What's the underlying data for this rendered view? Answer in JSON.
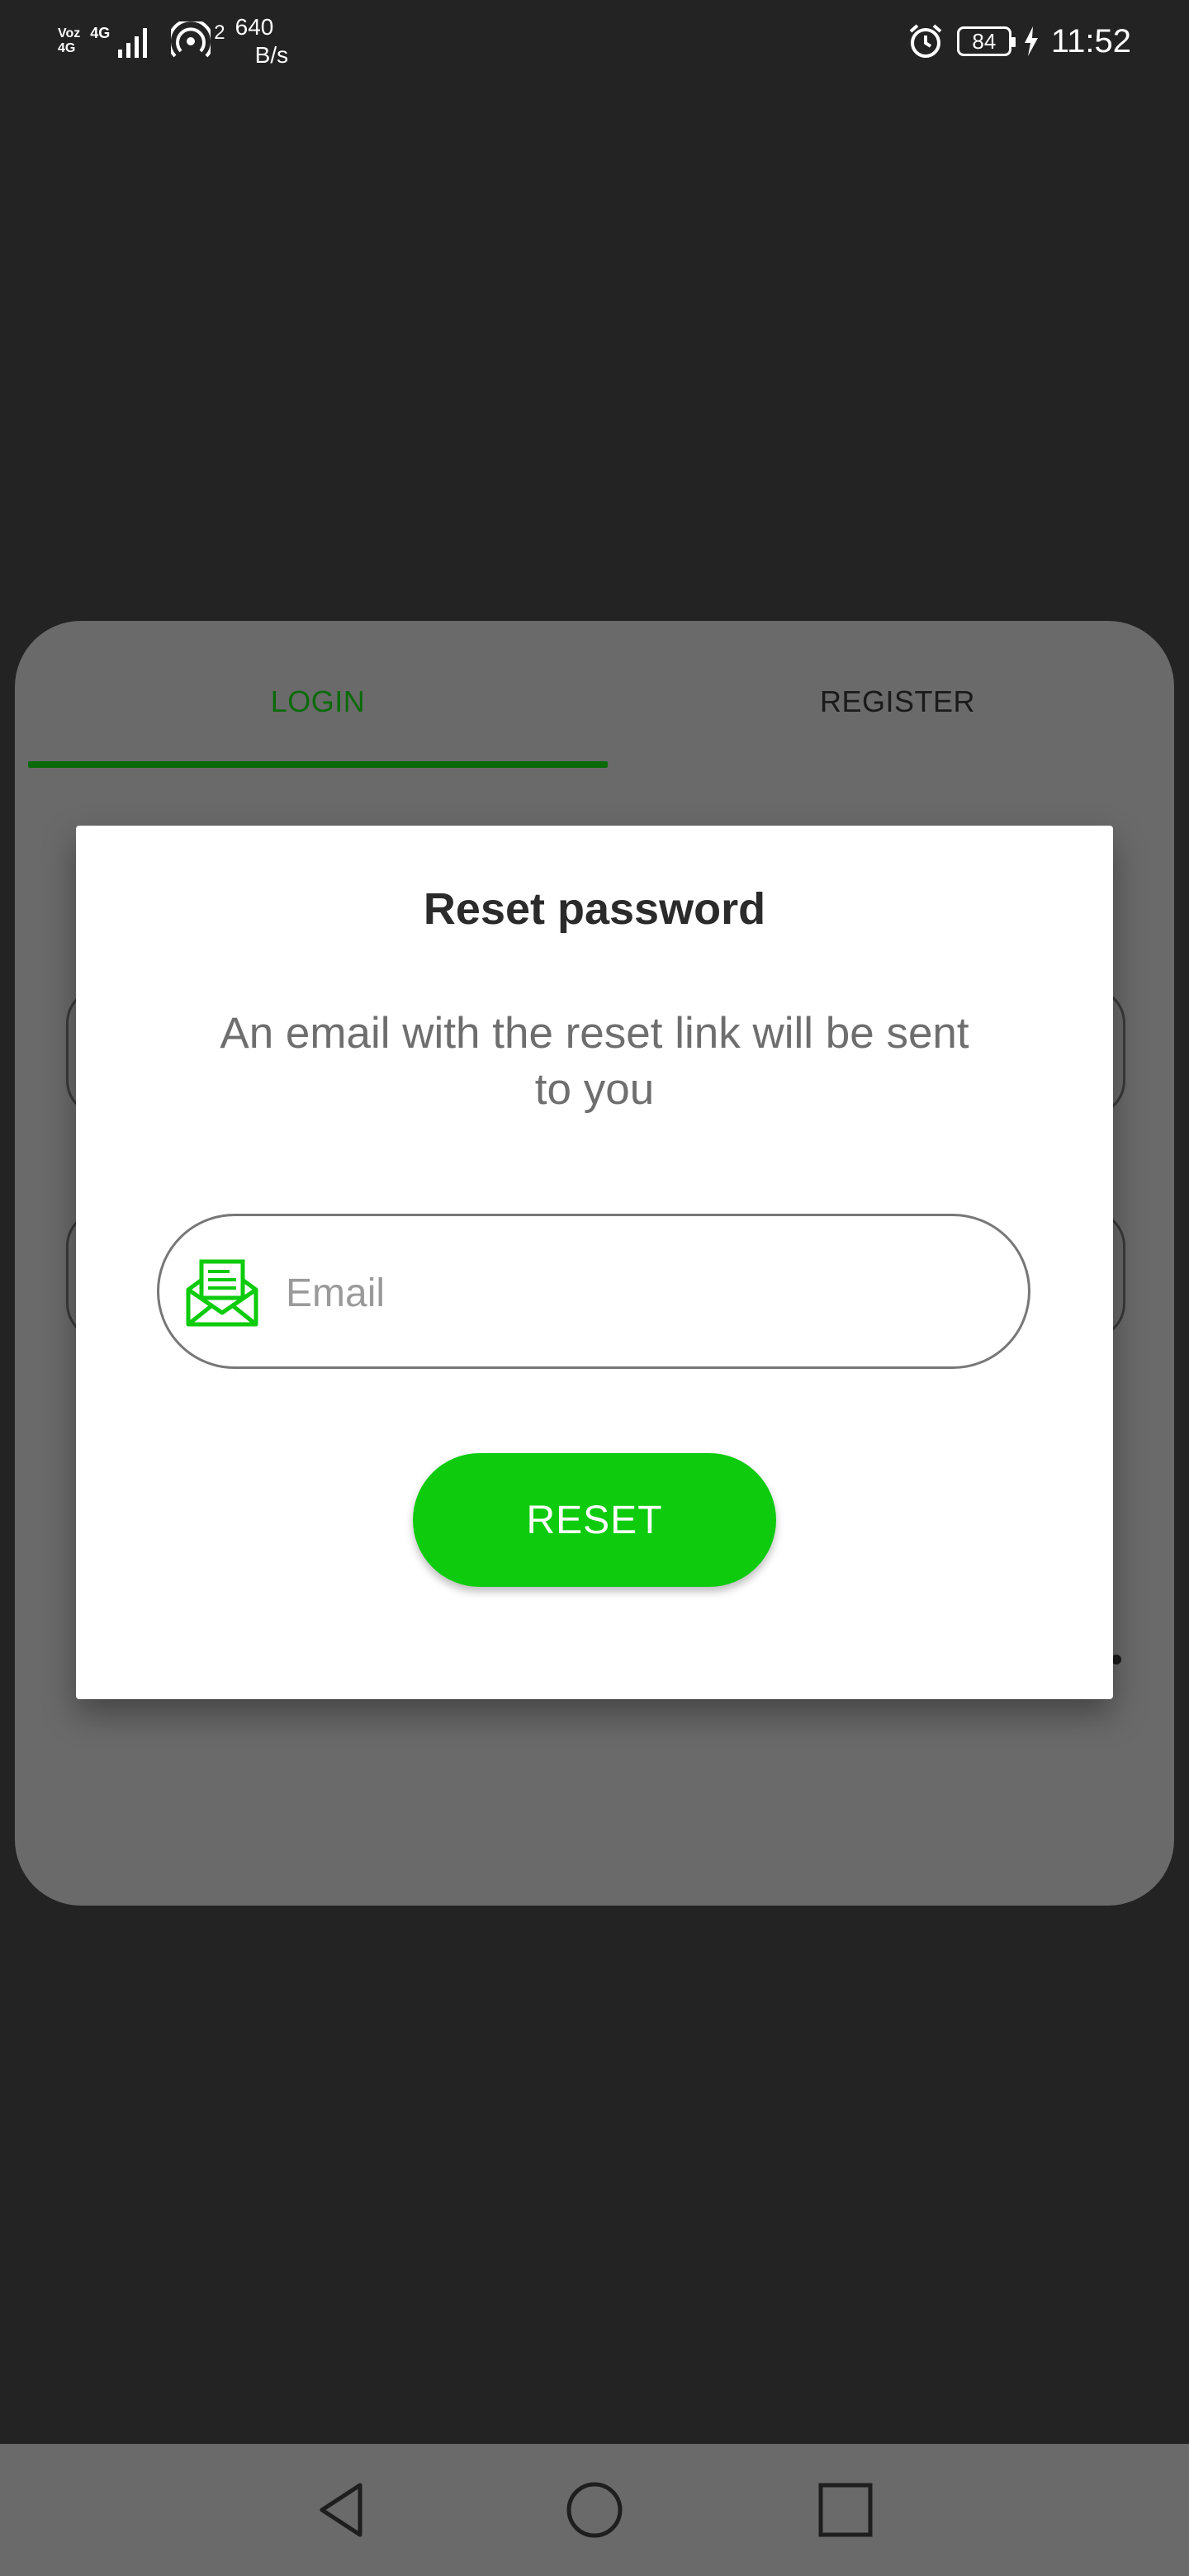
{
  "status_bar": {
    "carrier_top": "Voz",
    "carrier_bottom": "4G",
    "network_top": "4G",
    "hotspot_count": "2",
    "speed_value": "640",
    "speed_unit": "B/s",
    "battery": "84",
    "time": "11:52",
    "icons": [
      "signal-icon",
      "hotspot-icon",
      "alarm-icon",
      "battery-icon",
      "charging-icon"
    ]
  },
  "tabs": [
    {
      "label": "LOGIN",
      "active": true
    },
    {
      "label": "REGISTER",
      "active": false
    }
  ],
  "dialog": {
    "title": "Reset password",
    "message": "An email with the reset link will be sent to you",
    "email_placeholder": "Email",
    "email_value": "",
    "email_icon": "envelope-open-icon",
    "reset_label": "RESET"
  },
  "colors": {
    "accent": "#0ecb0e",
    "tab_active": "#0a6a0a",
    "background": "#232323",
    "card": "#6a6a6a"
  },
  "nav_bar": {
    "icons": [
      "back-icon",
      "home-icon",
      "recents-icon"
    ]
  }
}
